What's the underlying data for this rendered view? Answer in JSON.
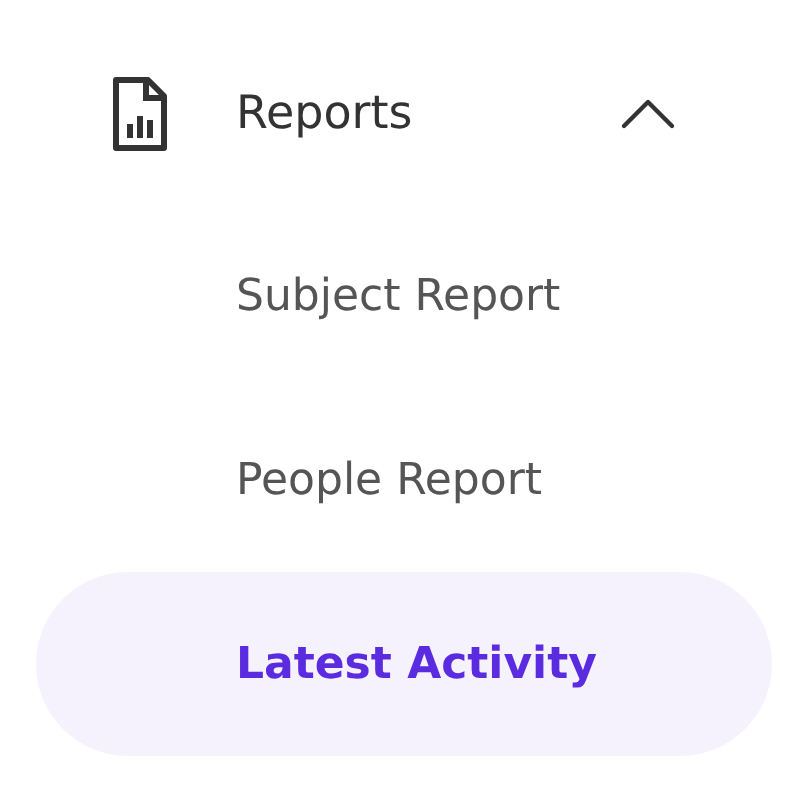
{
  "section": {
    "title": "Reports",
    "expanded": true,
    "items": [
      {
        "label": "Subject Report",
        "selected": false
      },
      {
        "label": "People Report",
        "selected": false
      },
      {
        "label": "Latest Activity",
        "selected": true
      }
    ]
  }
}
